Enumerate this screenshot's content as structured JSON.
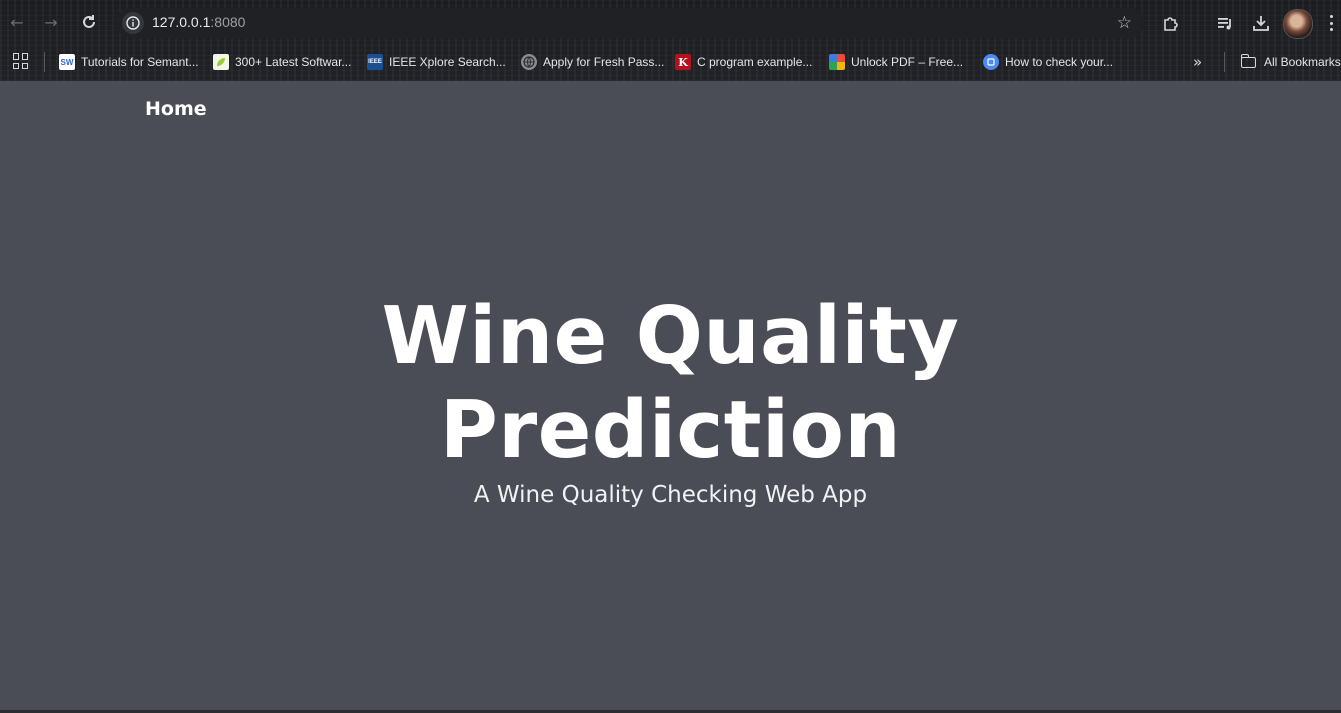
{
  "browser": {
    "url_host": "127.0.0.1",
    "url_port": ":8080",
    "bookmarks": [
      {
        "label": "Tutorials for Semant...",
        "icon": "sw-favicon",
        "fav_text": "SW",
        "fav_color": "#ffffff",
        "fav_text_color": "#3366cc"
      },
      {
        "label": "300+ Latest Softwar...",
        "icon": "leaf-favicon",
        "fav_text": "",
        "fav_color": "#9acd32",
        "fav_text_color": "#ffffff"
      },
      {
        "label": "IEEE Xplore Search...",
        "icon": "ieee-favicon",
        "fav_text": "IEEE",
        "fav_color": "#1b4f93",
        "fav_text_color": "#ffffff"
      },
      {
        "label": "Apply for Fresh Pass...",
        "icon": "globe-favicon",
        "fav_text": "",
        "fav_color": "#8a8d93",
        "fav_text_color": "#ffffff"
      },
      {
        "label": "C program example...",
        "icon": "k-favicon",
        "fav_text": "K",
        "fav_color": "#b3121d",
        "fav_text_color": "#ffffff"
      },
      {
        "label": "Unlock PDF – Free...",
        "icon": "ilovepdf-favicon",
        "fav_text": "",
        "fav_color": "#e94b3c",
        "fav_text_color": "#ffffff"
      },
      {
        "label": "How to check your...",
        "icon": "blue-circle-favicon",
        "fav_text": "",
        "fav_color": "#4a8af4",
        "fav_text_color": "#ffffff"
      }
    ],
    "all_bookmarks_label": "All Bookmarks"
  },
  "page": {
    "nav_home": "Home",
    "title_line1": "Wine Quality",
    "title_line2": "Prediction",
    "subtitle": "A Wine Quality Checking Web App"
  },
  "colors": {
    "page_background": "#4a4d55",
    "text": "#ffffff"
  }
}
